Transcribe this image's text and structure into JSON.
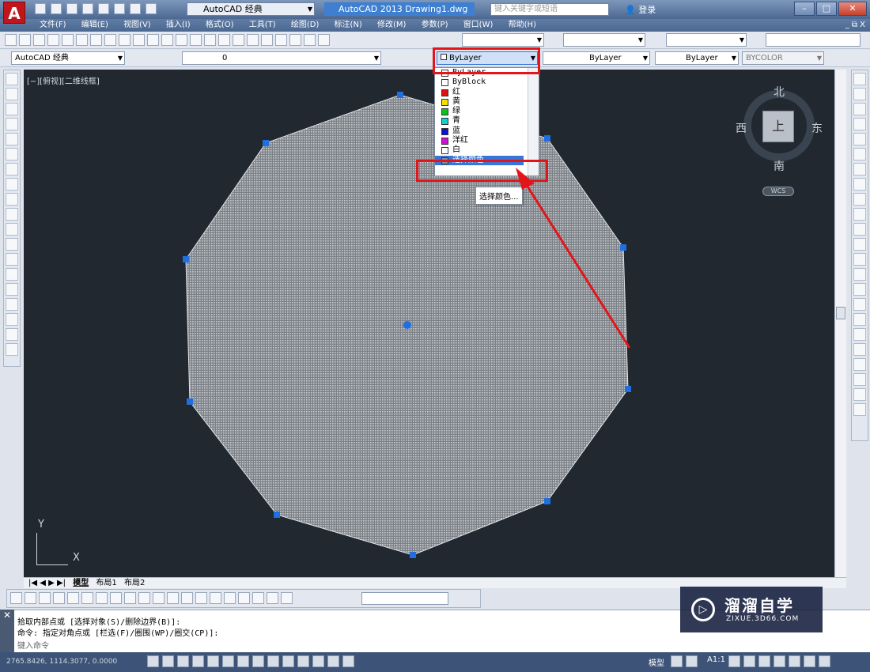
{
  "window": {
    "workspace": "AutoCAD 经典",
    "title": "AutoCAD 2013   Drawing1.dwg",
    "search_placeholder": "键入关键字或短语",
    "login": "登录"
  },
  "menubar": {
    "items": [
      "文件(F)",
      "编辑(E)",
      "视图(V)",
      "插入(I)",
      "格式(O)",
      "工具(T)",
      "绘图(D)",
      "标注(N)",
      "修改(M)",
      "参数(P)",
      "窗口(W)",
      "帮助(H)"
    ],
    "mdi_controls": "_ ⧉ X"
  },
  "toolbar2": {
    "workspace_combo": "AutoCAD 经典",
    "layer_combo": "0",
    "color_combo": "ByLayer",
    "linetype_combo": "ByLayer",
    "lineweight_combo": "ByLayer",
    "plotstyle_combo": "BYCOLOR"
  },
  "drawing": {
    "view_label": "[−][俯视][二维线框]",
    "viewcube": {
      "north": "北",
      "south": "南",
      "west": "西",
      "east": "东",
      "face": "上",
      "wcs": "WCS"
    },
    "ucs": {
      "y": "Y",
      "x": "X"
    }
  },
  "color_dropdown": {
    "options": [
      {
        "label": "ByLayer",
        "color": "#ffffff"
      },
      {
        "label": "ByBlock",
        "color": "#ffffff"
      },
      {
        "label": "红",
        "color": "#e01010"
      },
      {
        "label": "黄",
        "color": "#f2e100"
      },
      {
        "label": "绿",
        "color": "#10c020"
      },
      {
        "label": "青",
        "color": "#10d0d0"
      },
      {
        "label": "蓝",
        "color": "#1010d0"
      },
      {
        "label": "洋红",
        "color": "#d010d0"
      },
      {
        "label": "白",
        "color": "#ffffff"
      },
      {
        "label": "选择颜色...",
        "color": "#8090a0"
      }
    ],
    "tooltip": "选择颜色..."
  },
  "layout_tabs": {
    "nav": "|◀ ◀ ▶ ▶|",
    "model": "模型",
    "layout1": "布局1",
    "layout2": "布局2"
  },
  "command": {
    "line1": "拾取内部点或 [选择对象(S)/删除边界(B)]:",
    "line2": "命令: 指定对角点或 [栏选(F)/圈围(WP)/圈交(CP)]:",
    "prompt": "键入命令"
  },
  "status": {
    "coords": "2765.8426,  1114.3077, 0.0000",
    "model": "模型",
    "scale": "A1:1"
  },
  "watermark": {
    "line1": "溜溜自学",
    "line2": "ZIXUE.3D66.COM"
  },
  "colors": {
    "accent_red": "#e2151a",
    "select_blue": "#3875d7",
    "hatch": "#9a9fa5",
    "grip": "#1f6fe0"
  }
}
